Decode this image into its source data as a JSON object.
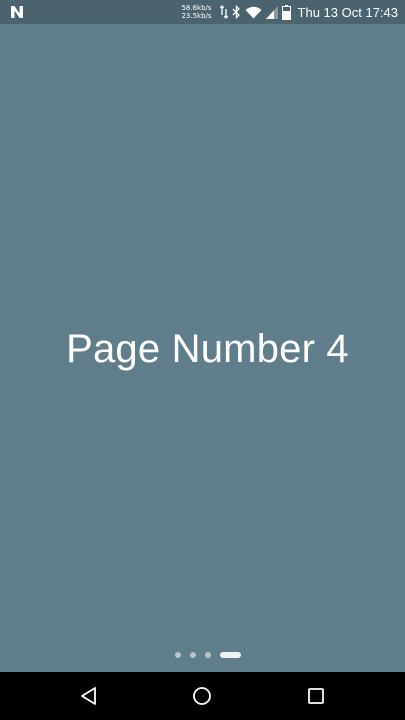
{
  "status_bar": {
    "app_notification_icon": "n-logo-icon",
    "net_speed_up": "58.6kb/s",
    "net_speed_down": "23.5kb/s",
    "icons": [
      "data-transfer-icon",
      "bluetooth-icon",
      "wifi-icon",
      "signal-icon",
      "battery-icon"
    ],
    "time": "Thu 13 Oct 17:43"
  },
  "main": {
    "title": "Page Number 4",
    "background_color": "#607d8b"
  },
  "page_indicator": {
    "total_pages": 4,
    "current_page": 4
  },
  "nav_bar": {
    "buttons": [
      "back-icon",
      "home-icon",
      "recents-icon"
    ]
  }
}
